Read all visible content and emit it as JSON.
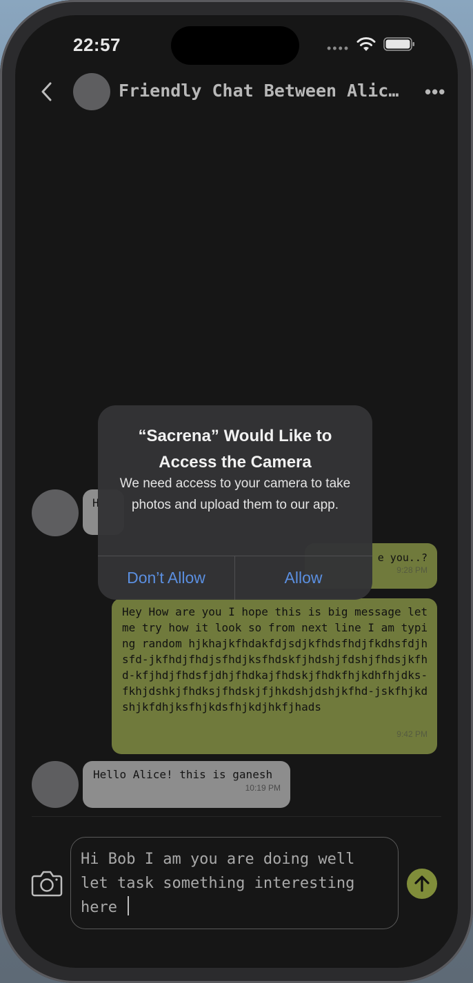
{
  "status_bar": {
    "time": "22:57",
    "signal_dots": "••••"
  },
  "header": {
    "title": "Friendly Chat Between Alic…",
    "more_label": "•••"
  },
  "messages": [
    {
      "side": "in",
      "text": "H",
      "time": ""
    },
    {
      "side": "out",
      "text": "e you..?",
      "time": "9:28 PM"
    },
    {
      "side": "out",
      "text": "Hey How are you I hope this is big message let me try how it look so from next line I am typing random hjkhajkfhdakfdjsdjkfhdsfhdjfkdhsfdjhsfd-jkfhdjfhdjsfhdjksfhdskfjhdshjfdshjfhdsjkfhd-kfjhdjfhdsfjdhjfhdkajfhdskjfhdkfhjkdhfhjdks-fkhjdshkjfhdksjfhdskjfjhkdshjdshjkfhd-jskfhjkdshjkfdhjksfhjkdsfhjkdjhkfjhads",
      "time": "9:42 PM"
    },
    {
      "side": "in",
      "text": "Hello Alice! this is ganesh",
      "time": "10:19 PM"
    }
  ],
  "dialog": {
    "title": "“Sacrena” Would Like to Access the Camera",
    "message": "We need access to your camera to take photos and upload them to our app.",
    "deny_label": "Don’t Allow",
    "allow_label": "Allow"
  },
  "composer": {
    "text": "Hi Bob I am you are doing well let task something interesting here "
  },
  "colors": {
    "outgoing_bubble": "#707a3c",
    "incoming_bubble": "#8d8d8d",
    "accent": "#808d3a",
    "alert_button": "#5b8fe0"
  }
}
